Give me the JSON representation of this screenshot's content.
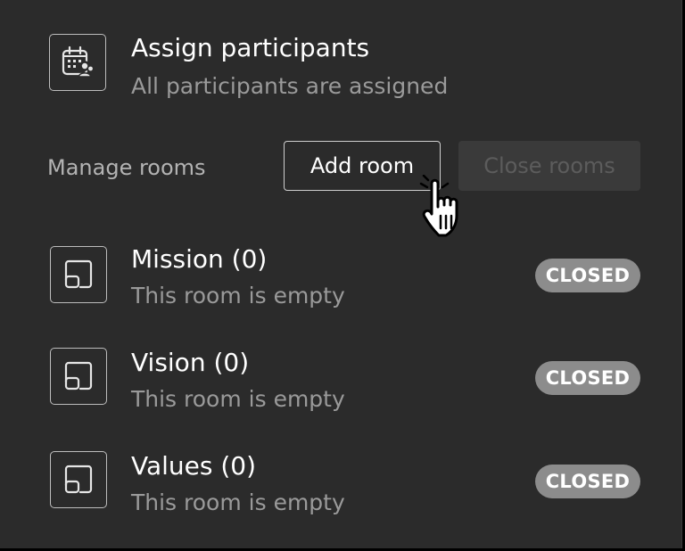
{
  "header": {
    "icon": "calendar-people-icon",
    "title": "Assign participants",
    "subtitle": "All participants are assigned"
  },
  "manage": {
    "label": "Manage rooms",
    "add_room_label": "Add room",
    "close_rooms_label": "Close rooms"
  },
  "rooms": [
    {
      "icon": "room-icon",
      "name": "Mission (0)",
      "status_text": "This room is empty",
      "badge": "CLOSED"
    },
    {
      "icon": "room-icon",
      "name": "Vision (0)",
      "status_text": "This room is empty",
      "badge": "CLOSED"
    },
    {
      "icon": "room-icon",
      "name": "Values (0)",
      "status_text": "This room is empty",
      "badge": "CLOSED"
    }
  ],
  "cursor": {
    "icon": "hand-pointer-cursor-icon"
  },
  "colors": {
    "panel_bg": "#2b2b2b",
    "badge_bg": "#8c8c8c",
    "disabled_button_bg": "#3a3a3a",
    "muted_text": "#9a9a9a"
  }
}
